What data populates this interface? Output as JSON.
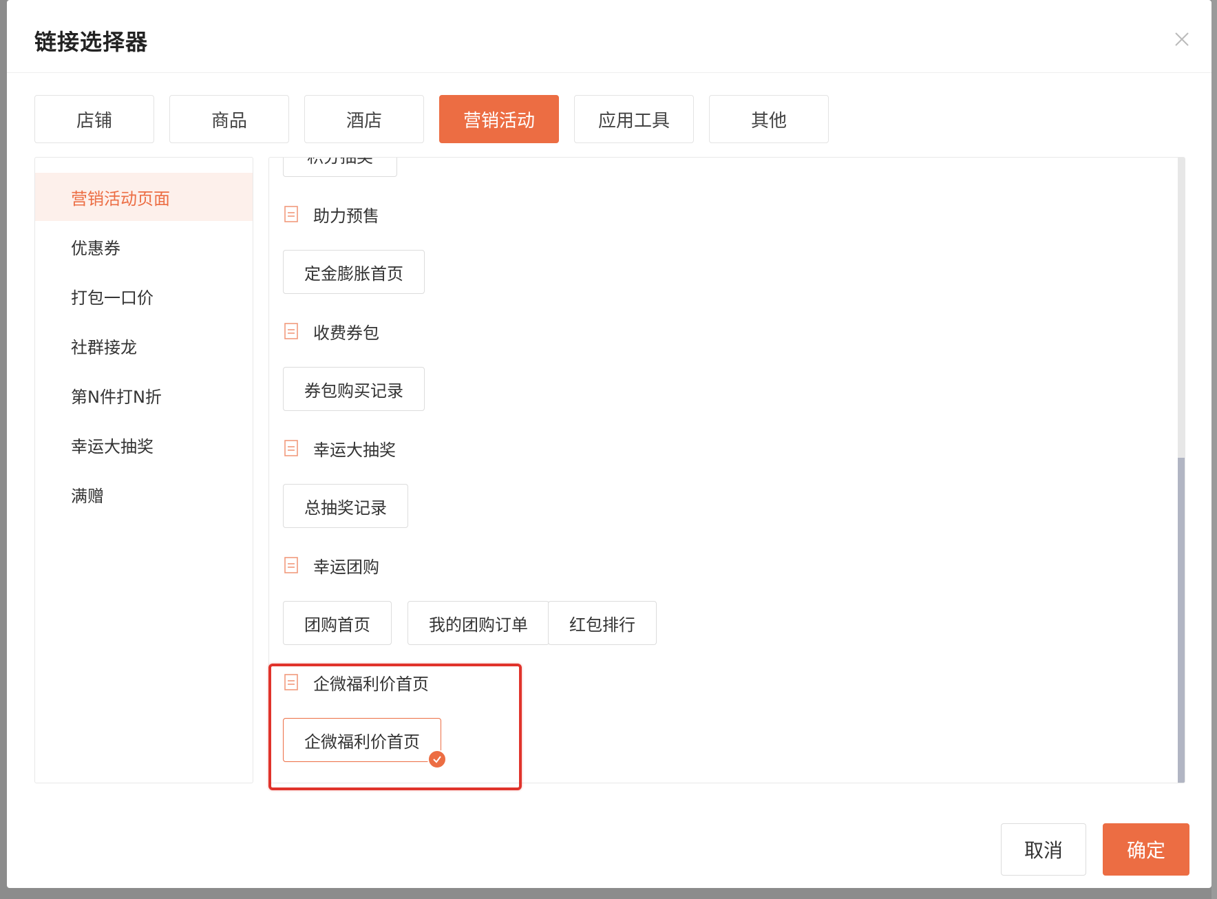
{
  "dialog": {
    "title": "链接选择器"
  },
  "tabs": [
    "店铺",
    "商品",
    "酒店",
    "营销活动",
    "应用工具",
    "其他"
  ],
  "active_tab": "营销活动",
  "sidebar": {
    "items": [
      "营销活动页面",
      "优惠券",
      "打包一口价",
      "社群接龙",
      "第N件打N折",
      "幸运大抽奖",
      "满赠"
    ],
    "active": "营销活动页面"
  },
  "content": {
    "partial_top_button": "积分抽奖",
    "groups": [
      {
        "title": "助力预售",
        "links": [
          "定金膨胀首页"
        ]
      },
      {
        "title": "收费券包",
        "links": [
          "券包购买记录"
        ]
      },
      {
        "title": "幸运大抽奖",
        "links": [
          "总抽奖记录"
        ]
      },
      {
        "title": "幸运团购",
        "links": [
          "团购首页",
          "我的团购订单",
          "红包排行"
        ]
      },
      {
        "title": "企微福利价首页",
        "links": [
          "企微福利价首页"
        ]
      }
    ],
    "selected_link": "企微福利价首页"
  },
  "footer": {
    "cancel_label": "取消",
    "confirm_label": "确定"
  },
  "colors": {
    "accent": "#ec6d43",
    "highlight": "#e0332b"
  }
}
